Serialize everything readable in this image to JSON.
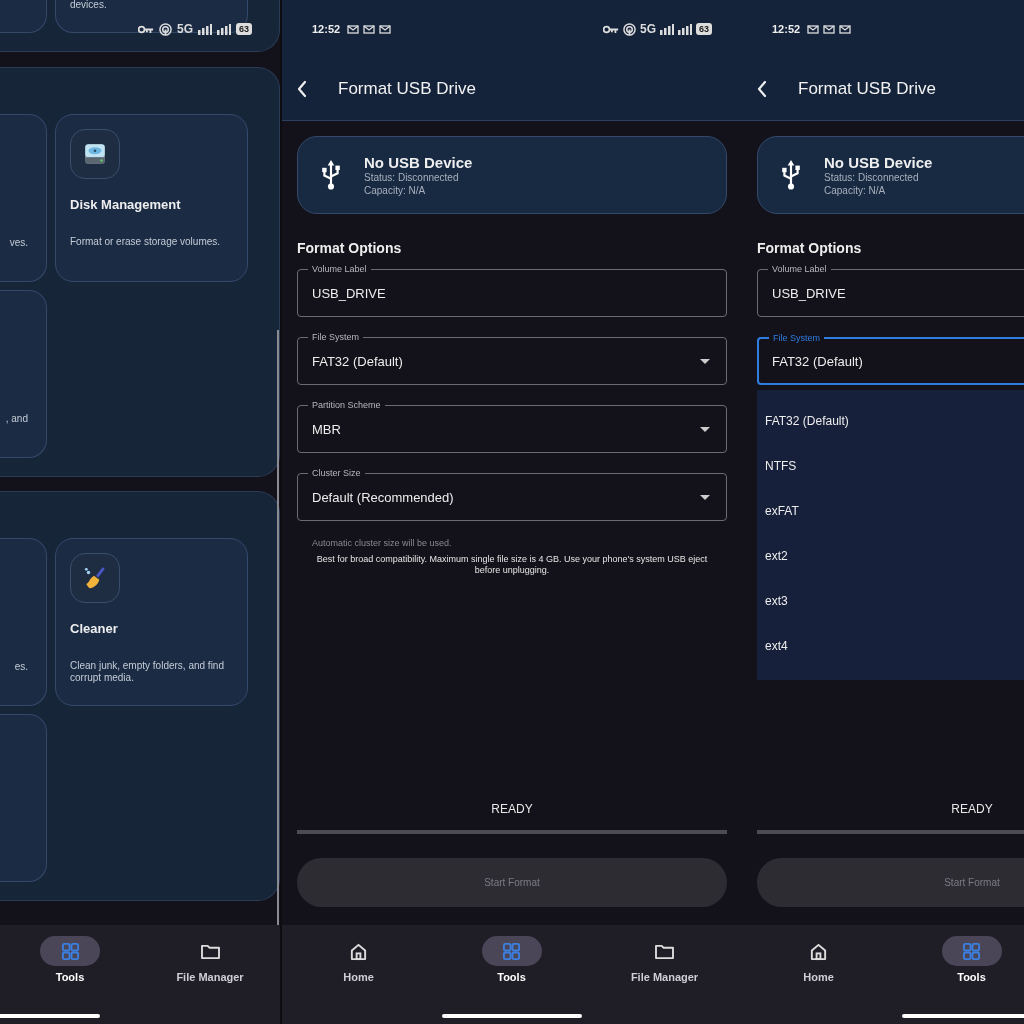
{
  "screens": [
    {
      "kind": "tools",
      "status_bar": {
        "network": "5G",
        "battery": "63"
      },
      "sections": [
        {
          "kind": "cut_top",
          "cards": [
            {
              "kind": "cut"
            },
            {
              "kind": "tool",
              "description": "devices."
            }
          ]
        },
        {
          "kind": "full",
          "cards": [
            {
              "kind": "cut",
              "text": "ves."
            },
            {
              "kind": "disk_tool",
              "title": "Disk Management",
              "description": "Format or erase storage volumes."
            },
            {
              "kind": "cut",
              "text": ", and"
            }
          ]
        },
        {
          "kind": "full",
          "cards": [
            {
              "kind": "cut",
              "text": "es."
            },
            {
              "kind": "cleaner_tool",
              "title": "Cleaner",
              "description": "Clean junk, empty folders, and find corrupt media."
            },
            {
              "kind": "cut"
            }
          ]
        }
      ],
      "nav": [
        {
          "label": "Tools",
          "kind": "tools",
          "selected": true
        },
        {
          "label": "File Manager",
          "kind": "files",
          "selected": false
        }
      ]
    },
    {
      "kind": "format",
      "status_bar": {
        "time": "12:52",
        "network": "5G",
        "battery": "63"
      },
      "title": "Format USB Drive",
      "device": {
        "title": "No USB Device",
        "status": "Status: Disconnected",
        "capacity": "Capacity: N/A"
      },
      "section_title": "Format Options",
      "fields": [
        {
          "kind": "text",
          "label": "Volume Label",
          "value": "USB_DRIVE",
          "focused": false
        },
        {
          "kind": "dropdown",
          "label": "File System",
          "value": "FAT32 (Default)",
          "focused": false
        },
        {
          "kind": "dropdown",
          "label": "Partition Scheme",
          "value": "MBR",
          "focused": false
        },
        {
          "kind": "dropdown",
          "label": "Cluster Size",
          "value": "Default (Recommended)",
          "focused": false
        }
      ],
      "hints": [
        {
          "kind": "muted",
          "text": "Automatic cluster size will be used."
        },
        {
          "kind": "info",
          "text": "Best for broad compatibility. Maximum single file size is 4 GB. Use your phone's system USB eject before unplugging."
        }
      ],
      "progress": {
        "label": "READY",
        "level": 0
      },
      "button": {
        "label": "Start Format",
        "disabled": true
      },
      "nav": [
        {
          "label": "Home",
          "kind": "home",
          "selected": false
        },
        {
          "label": "Tools",
          "kind": "tools",
          "selected": true
        },
        {
          "label": "File Manager",
          "kind": "files",
          "selected": false
        }
      ]
    },
    {
      "kind": "format",
      "status_bar": {
        "time": "12:52"
      },
      "title": "Format USB Drive",
      "device": {
        "title": "No USB Device",
        "status": "Status: Disconnected",
        "capacity": "Capacity: N/A"
      },
      "section_title": "Format Options",
      "fields": [
        {
          "kind": "text",
          "label": "Volume Label",
          "value": "USB_DRIVE",
          "focused": false
        },
        {
          "kind": "dropdown",
          "label": "File System",
          "value": "FAT32 (Default)",
          "focused": true
        }
      ],
      "menu": [
        "FAT32 (Default)",
        "NTFS",
        "exFAT",
        "ext2",
        "ext3",
        "ext4"
      ],
      "progress": {
        "label": "READY",
        "level": 0
      },
      "button": {
        "label": "Start Format",
        "disabled": true
      },
      "nav": [
        {
          "label": "Home",
          "kind": "home",
          "selected": false
        },
        {
          "label": "Tools",
          "kind": "tools",
          "selected": true
        }
      ]
    }
  ]
}
